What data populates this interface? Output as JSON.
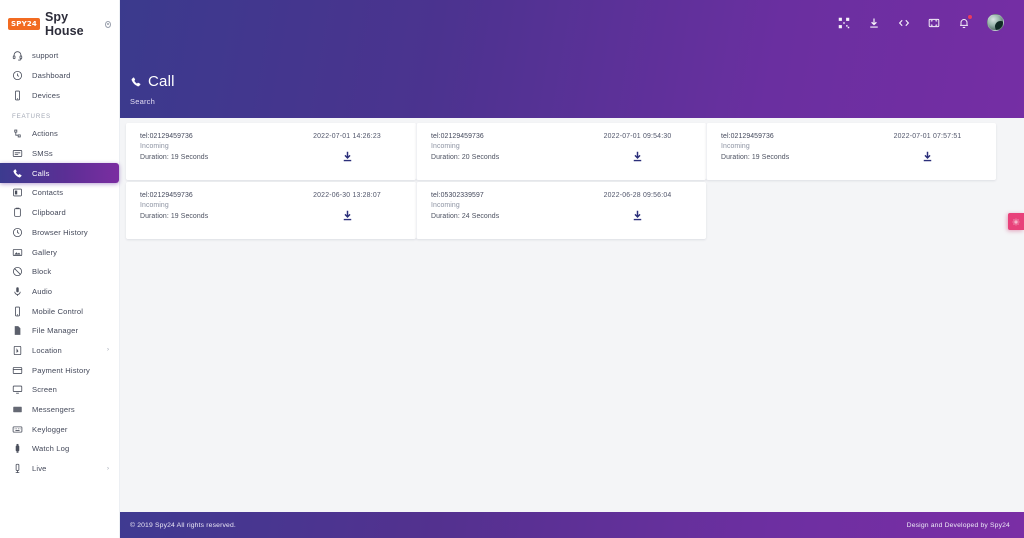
{
  "brand": {
    "logo_text": "SPY24",
    "name": "Spy House",
    "toggle_icon": "collapse-toggle-icon"
  },
  "sidebar": {
    "section_label": "FEATURES",
    "top_items": [
      {
        "label": "support",
        "icon": "headset-icon"
      },
      {
        "label": "Dashboard",
        "icon": "dashboard-clock-icon"
      },
      {
        "label": "Devices",
        "icon": "mobile-device-icon"
      }
    ],
    "feature_items": [
      {
        "label": "Actions",
        "icon": "actions-icon",
        "active": false,
        "caret": ""
      },
      {
        "label": "SMSs",
        "icon": "sms-icon",
        "active": false,
        "caret": ""
      },
      {
        "label": "Calls",
        "icon": "phone-icon",
        "active": true,
        "caret": ""
      },
      {
        "label": "Contacts",
        "icon": "contacts-icon",
        "active": false,
        "caret": ""
      },
      {
        "label": "Clipboard",
        "icon": "clipboard-icon",
        "active": false,
        "caret": ""
      },
      {
        "label": "Browser History",
        "icon": "history-clock-icon",
        "active": false,
        "caret": ""
      },
      {
        "label": "Gallery",
        "icon": "gallery-image-icon",
        "active": false,
        "caret": ""
      },
      {
        "label": "Block",
        "icon": "block-circle-icon",
        "active": false,
        "caret": ""
      },
      {
        "label": "Audio",
        "icon": "microphone-icon",
        "active": false,
        "caret": ""
      },
      {
        "label": "Mobile Control",
        "icon": "mobile-control-icon",
        "active": false,
        "caret": ""
      },
      {
        "label": "File Manager",
        "icon": "file-icon",
        "active": false,
        "caret": ""
      },
      {
        "label": "Location",
        "icon": "location-pin-icon",
        "active": false,
        "caret": "›"
      },
      {
        "label": "Payment History",
        "icon": "payment-card-icon",
        "active": false,
        "caret": ""
      },
      {
        "label": "Screen",
        "icon": "monitor-icon",
        "active": false,
        "caret": ""
      },
      {
        "label": "Messengers",
        "icon": "messengers-icon",
        "active": false,
        "caret": ""
      },
      {
        "label": "Keylogger",
        "icon": "keyboard-icon",
        "active": false,
        "caret": ""
      },
      {
        "label": "Watch Log",
        "icon": "watch-icon",
        "active": false,
        "caret": ""
      },
      {
        "label": "Live",
        "icon": "live-stream-icon",
        "active": false,
        "caret": "›"
      }
    ]
  },
  "topbar": {
    "icons": [
      {
        "name": "qr-code-icon"
      },
      {
        "name": "download-icon"
      },
      {
        "name": "code-brackets-icon"
      },
      {
        "name": "fullscreen-icon"
      },
      {
        "name": "notification-bell-icon",
        "badge": true
      },
      {
        "name": "user-avatar"
      }
    ],
    "page_title": "Call",
    "page_title_icon": "phone-icon",
    "search_label": "Search"
  },
  "calls": [
    {
      "tel": "tel:02129459736",
      "direction": "Incoming",
      "duration": "Duration: 19 Seconds",
      "datetime": "2022-07-01 14:26:23",
      "download_icon": "download-icon"
    },
    {
      "tel": "tel:02129459736",
      "direction": "Incoming",
      "duration": "Duration: 20 Seconds",
      "datetime": "2022-07-01 09:54:30",
      "download_icon": "download-icon"
    },
    {
      "tel": "tel:02129459736",
      "direction": "Incoming",
      "duration": "Duration: 19 Seconds",
      "datetime": "2022-07-01 07:57:51",
      "download_icon": "download-icon"
    },
    {
      "tel": "tel:02129459736",
      "direction": "Incoming",
      "duration": "Duration: 19 Seconds",
      "datetime": "2022-06-30 13:28:07",
      "download_icon": "download-icon"
    },
    {
      "tel": "tel:05302339597",
      "direction": "Incoming",
      "duration": "Duration: 24 Seconds",
      "datetime": "2022-06-28 09:56:04",
      "download_icon": "download-icon"
    }
  ],
  "settings_tab": {
    "icon": "gear-icon"
  },
  "footer": {
    "copyright": "© 2019 Spy24 All rights reserved.",
    "credit": "Design and Developed by Spy24"
  },
  "colors": {
    "brand_orange": "#f26b21",
    "header_start": "#3b3a8d",
    "header_end": "#752ea4",
    "accent_pink": "#e8417a",
    "notification_red": "#f23b5c",
    "download_blue": "#2b2f7a"
  }
}
